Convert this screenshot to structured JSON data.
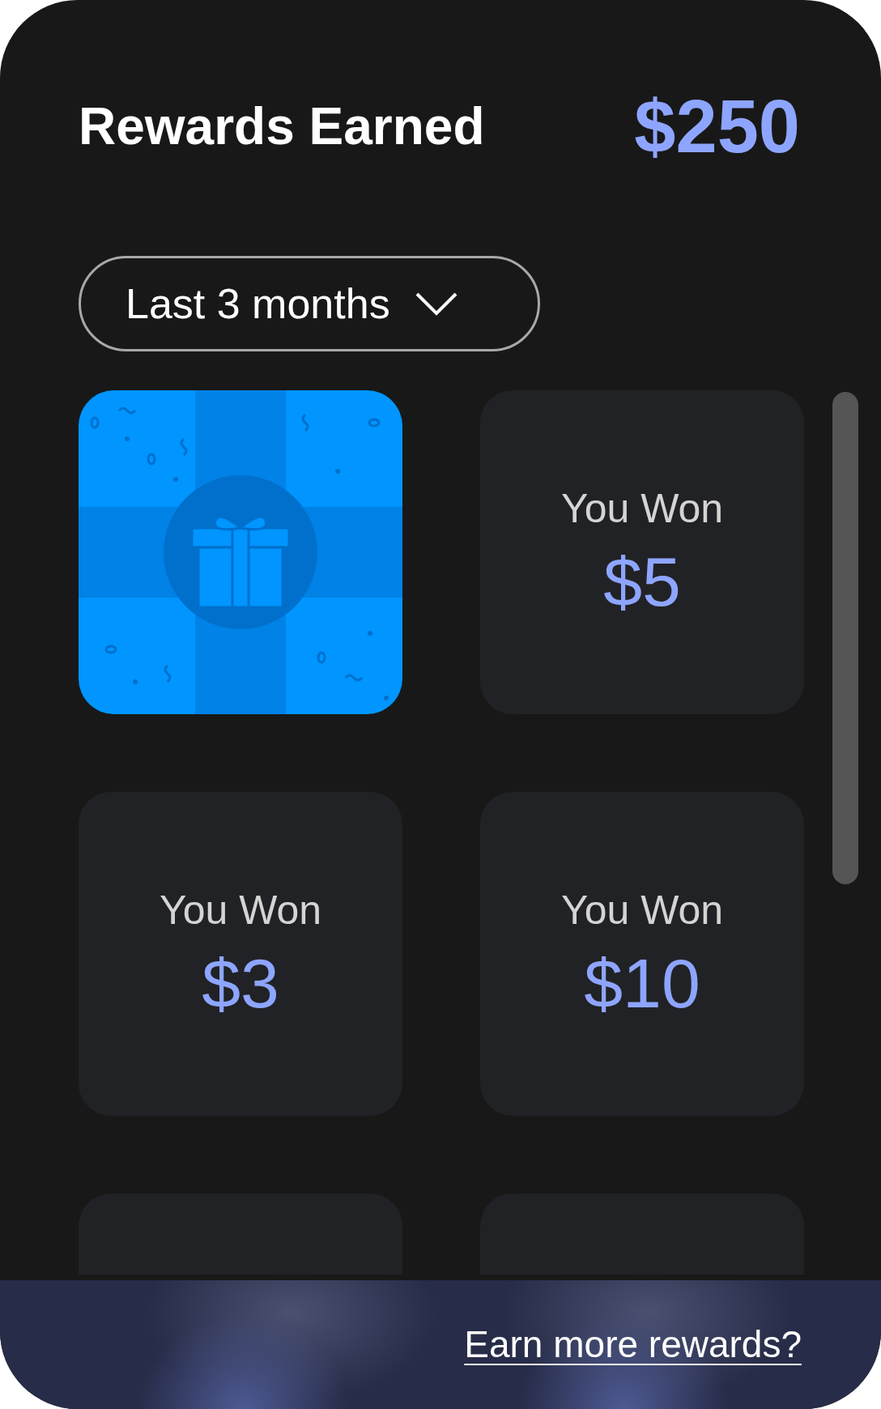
{
  "header": {
    "title": "Rewards Earned",
    "total": "$250"
  },
  "filter": {
    "label": "Last 3 months"
  },
  "rewards": [
    {
      "kind": "gift"
    },
    {
      "kind": "won",
      "label": "You Won",
      "amount": "$5"
    },
    {
      "kind": "won",
      "label": "You Won",
      "amount": "$3"
    },
    {
      "kind": "won",
      "label": "You Won",
      "amount": "$10"
    },
    {
      "kind": "blank"
    },
    {
      "kind": "blank"
    }
  ],
  "footer": {
    "link": "Earn more rewards?"
  }
}
